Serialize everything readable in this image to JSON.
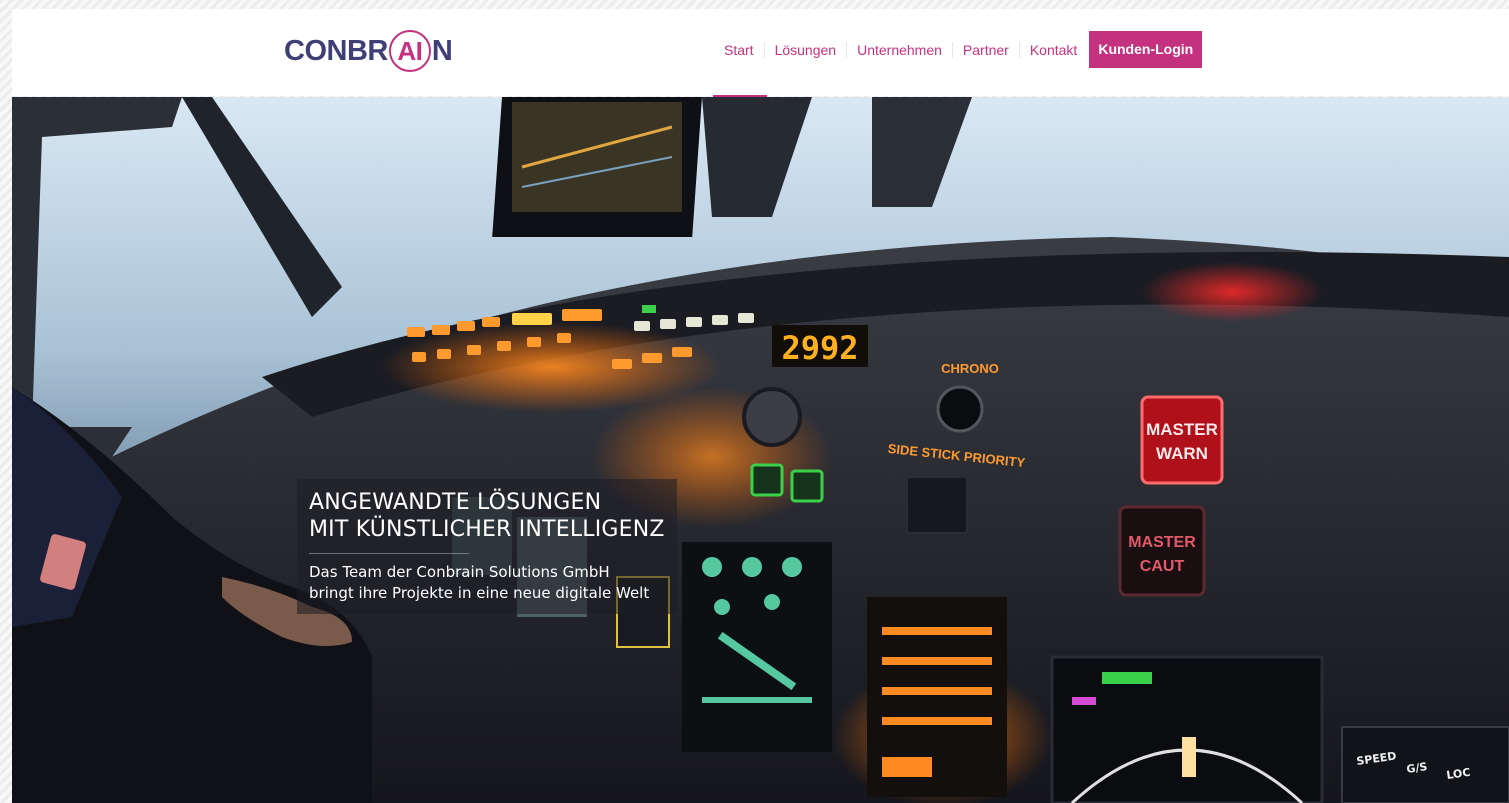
{
  "brand": {
    "logo_prefix": "CONBR",
    "logo_ring": "AI",
    "logo_suffix": "N",
    "primary_color": "#c4327f",
    "logo_color": "#3f3f78"
  },
  "nav": {
    "items": [
      {
        "label": "Start",
        "active": true
      },
      {
        "label": "Lösungen"
      },
      {
        "label": "Unternehmen"
      },
      {
        "label": "Partner"
      },
      {
        "label": "Kontakt"
      }
    ],
    "login_label": "Kunden-Login"
  },
  "hero": {
    "title_line1": "ANGEWANDTE LÖSUNGEN",
    "title_line2": "MIT KÜNSTLICHER INTELLIGENZ",
    "subtitle_line1": "Das Team der Conbrain Solutions GmbH",
    "subtitle_line2": "bringt ihre Projekte in eine neue digitale Welt",
    "panel_display": "2992",
    "panel_chrono": "CHRONO",
    "panel_side_stick": "SIDE STICK PRIORITY",
    "panel_master_warn_1": "MASTER",
    "panel_master_warn_2": "WARN",
    "panel_master_caut_1": "MASTER",
    "panel_master_caut_2": "CAUT",
    "panel_speed": "SPEED",
    "panel_gs": "G/S",
    "panel_loc": "LOC"
  }
}
